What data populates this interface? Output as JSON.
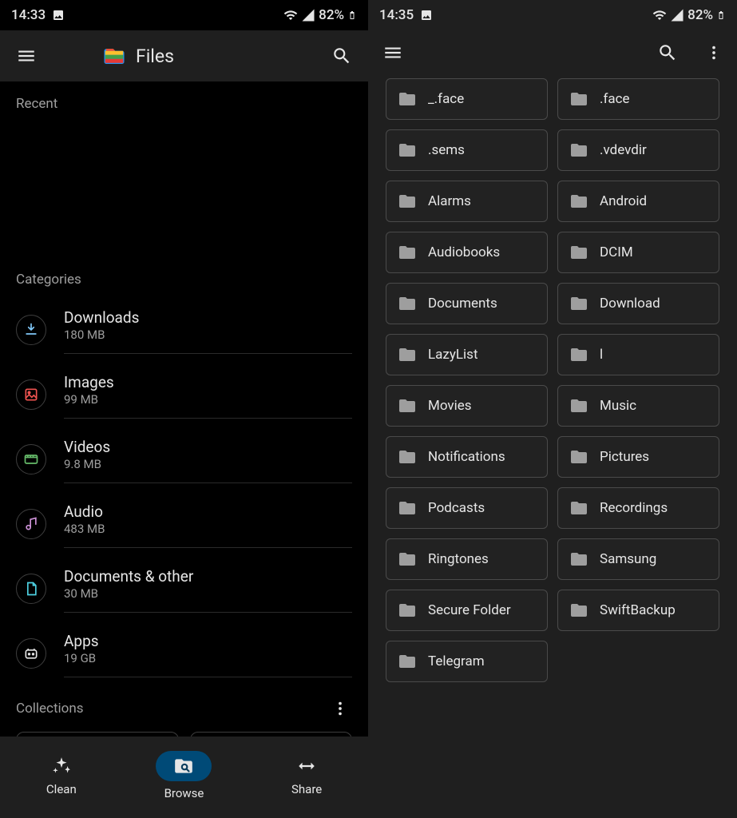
{
  "left": {
    "status": {
      "time": "14:33",
      "battery": "82%"
    },
    "app_title": "Files",
    "recent_title": "Recent",
    "categories_title": "Categories",
    "categories": [
      {
        "name": "Downloads",
        "size": "180 MB"
      },
      {
        "name": "Images",
        "size": "99 MB"
      },
      {
        "name": "Videos",
        "size": "9.8 MB"
      },
      {
        "name": "Audio",
        "size": "483 MB"
      },
      {
        "name": "Documents & other",
        "size": "30 MB"
      },
      {
        "name": "Apps",
        "size": "19 GB"
      }
    ],
    "collections_title": "Collections",
    "nav": {
      "clean": "Clean",
      "browse": "Browse",
      "share": "Share",
      "active": "browse"
    }
  },
  "right": {
    "status": {
      "time": "14:35",
      "battery": "82%"
    },
    "folders": [
      "_.face",
      ".face",
      ".sems",
      ".vdevdir",
      "Alarms",
      "Android",
      "Audiobooks",
      "DCIM",
      "Documents",
      "Download",
      "LazyList",
      "l",
      "Movies",
      "Music",
      "Notifications",
      "Pictures",
      "Podcasts",
      "Recordings",
      "Ringtones",
      "Samsung",
      "Secure Folder",
      "SwiftBackup",
      "Telegram"
    ]
  },
  "icons": {
    "menu": "menu-icon",
    "search": "search-icon",
    "more": "more-icon",
    "gallery": "gallery-icon"
  }
}
